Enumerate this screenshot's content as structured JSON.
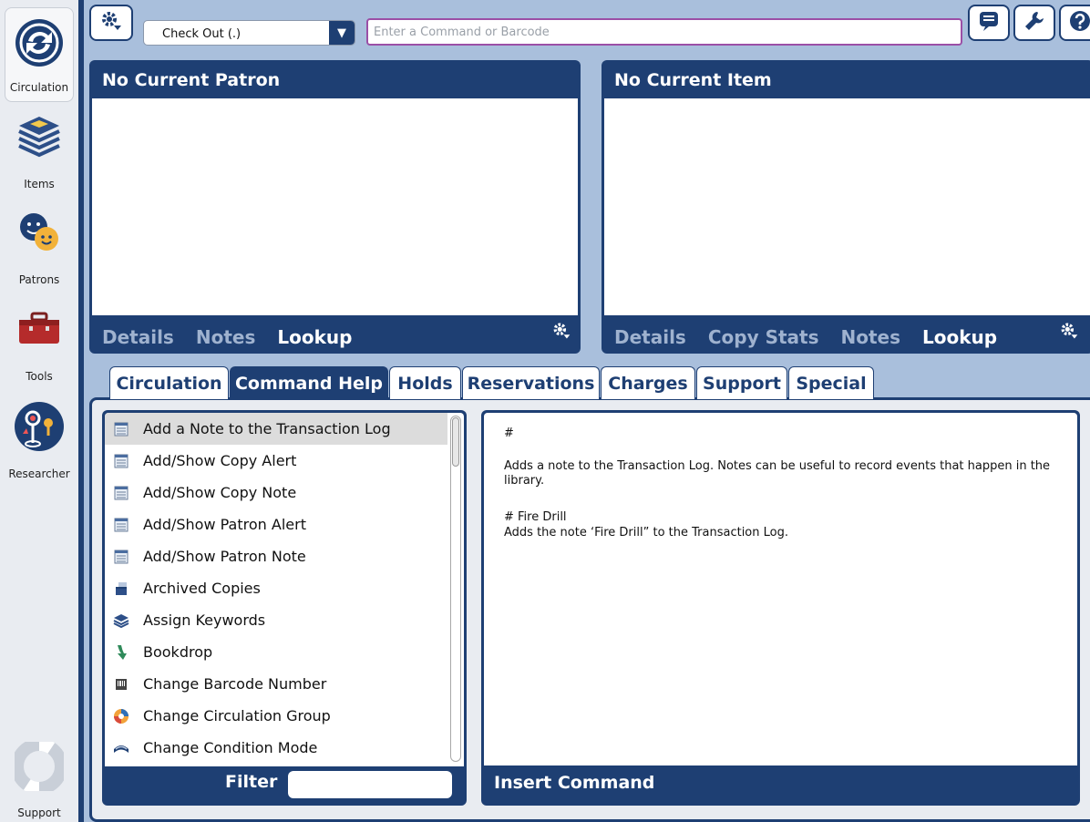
{
  "sidebar": {
    "items": [
      {
        "label": "Circulation",
        "icon": "circulation-icon"
      },
      {
        "label": "Items",
        "icon": "books-stack-icon"
      },
      {
        "label": "Patrons",
        "icon": "patrons-faces-icon"
      },
      {
        "label": "Tools",
        "icon": "toolbox-icon"
      },
      {
        "label": "Researcher",
        "icon": "researcher-icon"
      },
      {
        "label": "Support",
        "icon": "lifebuoy-icon"
      }
    ]
  },
  "toolbar": {
    "mode_value": "Check Out (.)",
    "command_placeholder": "Enter a Command or Barcode"
  },
  "patron_panel": {
    "title": "No Current Patron",
    "footer_links": [
      "Details",
      "Notes",
      "Lookup"
    ]
  },
  "item_panel": {
    "title": "No Current Item",
    "footer_links": [
      "Details",
      "Copy Stats",
      "Notes",
      "Lookup"
    ]
  },
  "tabs": [
    "Circulation",
    "Command Help",
    "Holds",
    "Reservations",
    "Charges",
    "Support",
    "Special"
  ],
  "active_tab": "Command Help",
  "command_list": [
    {
      "label": "Add a Note to the Transaction Log",
      "icon": "log-note-icon"
    },
    {
      "label": "Add/Show Copy Alert",
      "icon": "log-note-icon"
    },
    {
      "label": "Add/Show Copy Note",
      "icon": "log-note-icon"
    },
    {
      "label": "Add/Show Patron Alert",
      "icon": "log-note-icon"
    },
    {
      "label": "Add/Show Patron Note",
      "icon": "log-note-icon"
    },
    {
      "label": "Archived Copies",
      "icon": "archive-box-icon"
    },
    {
      "label": "Assign Keywords",
      "icon": "books-stack-icon"
    },
    {
      "label": "Bookdrop",
      "icon": "down-arrow-icon"
    },
    {
      "label": "Change Barcode Number",
      "icon": "barcode-icon"
    },
    {
      "label": "Change Circulation Group",
      "icon": "circulation-group-icon"
    },
    {
      "label": "Change Condition Mode",
      "icon": "book-icon"
    }
  ],
  "filter_label": "Filter",
  "help": {
    "line1": "#",
    "line2": "Adds a note to the Transaction Log. Notes can be useful to record events that happen in the library.",
    "line3": "# Fire Drill",
    "line4": "Adds the note ‘Fire Drill” to the Transaction Log."
  },
  "insert_command_label": "Insert Command",
  "colors": {
    "navy": "#1e3f73",
    "background": "#a9bfdc",
    "input_border": "#9b4fa6"
  }
}
